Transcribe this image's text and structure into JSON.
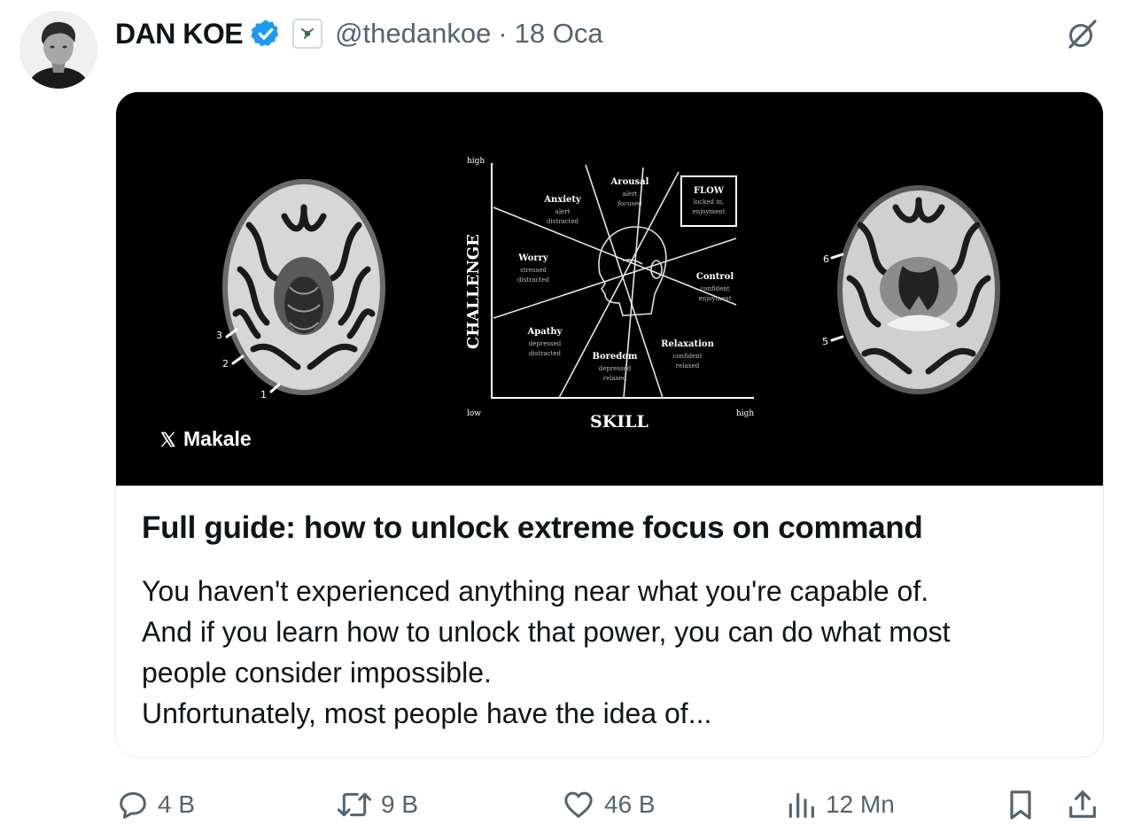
{
  "author": {
    "name": "DAN KOE",
    "handle": "@thedankoe",
    "separator": "·",
    "date": "18 Oca"
  },
  "card": {
    "type_label": "Makale",
    "title": "Full guide: how to unlock extreme focus on command",
    "description_lines": {
      "0": "You haven't experienced anything near what you're capable of.",
      "1": "And if you learn how to unlock that power, you can do what most",
      "2": "people consider impossible.",
      "3": "Unfortunately, most people have the idea of..."
    },
    "image": {
      "y_axis": "CHALLENGE",
      "x_axis": "SKILL",
      "high_y": "high",
      "low": "low",
      "high_x": "high",
      "flow": "FLOW",
      "flow_sub1": "locked in,",
      "flow_sub2": "enjoyment",
      "arousal": "Arousal",
      "arousal_sub1": "alert",
      "arousal_sub2": "focused",
      "anxiety": "Anxiety",
      "anxiety_sub1": "alert",
      "anxiety_sub2": "distracted",
      "worry": "Worry",
      "worry_sub1": "stressed",
      "worry_sub2": "distracted",
      "control": "Control",
      "control_sub1": "confident",
      "control_sub2": "enjoyment",
      "apathy": "Apathy",
      "apathy_sub1": "depressed",
      "apathy_sub2": "distracted",
      "boredom": "Boredom",
      "boredom_sub1": "depressed",
      "boredom_sub2": "relaxed",
      "relaxation": "Relaxation",
      "relaxation_sub1": "confident",
      "relaxation_sub2": "relaxed",
      "scan_marks": {
        "m1": "1",
        "m2": "2",
        "m3": "3",
        "m5": "5",
        "m6": "6"
      }
    }
  },
  "actions": {
    "replies": "4 B",
    "reposts": "9 B",
    "likes": "46 B",
    "views": "12 Mn"
  },
  "colors": {
    "verified": "#1d9bf0",
    "secondary_text": "#536471",
    "image_bg": "#000000"
  }
}
